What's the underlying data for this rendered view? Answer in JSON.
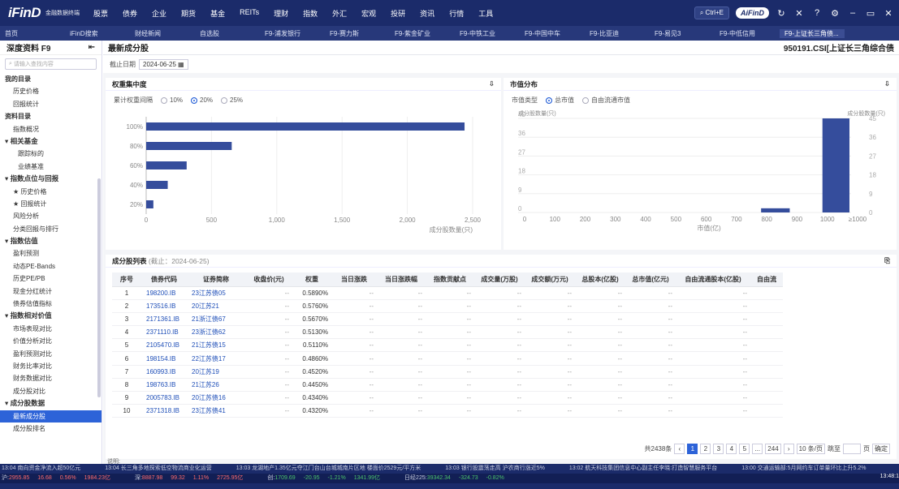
{
  "app": {
    "logo": "iFinD",
    "logo_sub": "金融数据终端",
    "menu": [
      "股票",
      "债券",
      "企业",
      "期货",
      "基金",
      "REITs",
      "理财",
      "指数",
      "外汇",
      "宏观",
      "投研",
      "资讯",
      "行情",
      "工具"
    ],
    "search_hint": "Ctrl+E",
    "aifind": "AiFinD"
  },
  "tabs": [
    "首页",
    "iFinD搜索",
    "财经新闻",
    "自选股",
    "F9-浦发银行",
    "F9-赛力斯",
    "F9-紫金矿业",
    "F9-中铁工业",
    "F9-中国中车",
    "F9-比亚迪",
    "F9-易见3",
    "F9-中低信用",
    "F9-上证长三角债..."
  ],
  "sidebar": {
    "title": "深度资料 F9",
    "search_placeholder": "请输入查找内容",
    "items": [
      {
        "t": "我的目录",
        "k": "g"
      },
      {
        "t": "历史价格",
        "k": "i"
      },
      {
        "t": "回报统计",
        "k": "i"
      },
      {
        "t": "资料目录",
        "k": "g"
      },
      {
        "t": "指数概况",
        "k": "i"
      },
      {
        "t": "▾ 相关基金",
        "k": "s"
      },
      {
        "t": "跟踪标的",
        "k": "i2"
      },
      {
        "t": "业绩基准",
        "k": "i2"
      },
      {
        "t": "▾ 指数点位与回报",
        "k": "s"
      },
      {
        "t": "★ 历史价格",
        "k": "i"
      },
      {
        "t": "★ 回报统计",
        "k": "i"
      },
      {
        "t": "风险分析",
        "k": "i"
      },
      {
        "t": "分类回报与排行",
        "k": "i"
      },
      {
        "t": "▾ 指数估值",
        "k": "s"
      },
      {
        "t": "盈利预测",
        "k": "i"
      },
      {
        "t": "动态PE-Bands",
        "k": "i"
      },
      {
        "t": "历史PE/PB",
        "k": "i"
      },
      {
        "t": "现金分红统计",
        "k": "i"
      },
      {
        "t": "债券估值指标",
        "k": "i"
      },
      {
        "t": "▾ 指数相对价值",
        "k": "s"
      },
      {
        "t": "市场表现对比",
        "k": "i"
      },
      {
        "t": "价值分析对比",
        "k": "i"
      },
      {
        "t": "盈利预测对比",
        "k": "i"
      },
      {
        "t": "财务比率对比",
        "k": "i"
      },
      {
        "t": "财务数据对比",
        "k": "i"
      },
      {
        "t": "成分股对比",
        "k": "i"
      },
      {
        "t": "▾ 成分股数据",
        "k": "s"
      },
      {
        "t": "最新成分股",
        "k": "a"
      },
      {
        "t": "成分股排名",
        "k": "i"
      }
    ]
  },
  "page": {
    "title": "最新成分股",
    "index_name": "950191.CSI[上证长三角综合债",
    "date_label": "截止日期",
    "date": "2024-06-25"
  },
  "weight_panel": {
    "title": "权重集中度",
    "radio_label": "累计权重间隔",
    "options": [
      "10%",
      "20%",
      "25%"
    ],
    "selected": "20%",
    "x_label": "成分股数量(只)"
  },
  "cap_panel": {
    "title": "市值分布",
    "radio_label": "市值类型",
    "options": [
      "总市值",
      "自由流通市值"
    ],
    "selected": "总市值",
    "y_label": "成分股数量(只)",
    "x_label": "市值(亿)"
  },
  "chart_data": [
    {
      "type": "bar",
      "orientation": "horizontal",
      "categories": [
        "100%",
        "80%",
        "60%",
        "40%",
        "20%"
      ],
      "values": [
        2438,
        655,
        310,
        165,
        55
      ],
      "xlim": [
        0,
        2500
      ],
      "xticks": [
        "0",
        "500",
        "1,000",
        "1,500",
        "2,000",
        "2,500"
      ],
      "xlabel": "成分股数量(只)"
    },
    {
      "type": "bar",
      "categories": [
        "0",
        "100",
        "200",
        "300",
        "400",
        "500",
        "600",
        "700",
        "800",
        "900",
        "1000",
        "≥1000"
      ],
      "values": [
        0,
        0,
        0,
        0,
        0,
        0,
        0,
        0,
        2,
        0,
        0,
        45
      ],
      "ylim": [
        0,
        45
      ],
      "yticks": [
        "0",
        "9",
        "18",
        "27",
        "36",
        "45"
      ],
      "ylabel": "成分股数量(只)",
      "xlabel": "市值(亿)"
    }
  ],
  "table": {
    "title": "成分股列表",
    "subtitle": "(截止：2024-06-25)",
    "headers": [
      "序号",
      "债券代码",
      "证券简称",
      "收盘价(元)",
      "权重",
      "当日涨跌",
      "当日涨跌幅",
      "指数贡献点",
      "成交量(万股)",
      "成交额(万元)",
      "总股本(亿股)",
      "总市值(亿元)",
      "自由流通股本(亿股)",
      "自由流"
    ],
    "rows": [
      [
        "1",
        "198200.IB",
        "23江苏债05",
        "--",
        "0.5890%"
      ],
      [
        "2",
        "173516.IB",
        "20江苏21",
        "--",
        "0.5760%"
      ],
      [
        "3",
        "2171361.IB",
        "21浙江债67",
        "--",
        "0.5670%"
      ],
      [
        "4",
        "2371110.IB",
        "23浙江债62",
        "--",
        "0.5130%"
      ],
      [
        "5",
        "2105470.IB",
        "21江苏债15",
        "--",
        "0.5110%"
      ],
      [
        "6",
        "198154.IB",
        "22江苏债17",
        "--",
        "0.4860%"
      ],
      [
        "7",
        "160993.IB",
        "20江苏19",
        "--",
        "0.4520%"
      ],
      [
        "8",
        "198763.IB",
        "21江苏26",
        "--",
        "0.4450%"
      ],
      [
        "9",
        "2005783.IB",
        "20江苏债16",
        "--",
        "0.4340%"
      ],
      [
        "10",
        "2371318.IB",
        "23江苏债41",
        "--",
        "0.4320%"
      ]
    ],
    "total": "共2438条",
    "pages": [
      "1",
      "2",
      "3",
      "4",
      "5",
      "...",
      "244"
    ],
    "per_page": "10 条/页",
    "jump": "跳至",
    "page_unit": "页",
    "confirm": "确定",
    "note": "说明:"
  },
  "ticker": {
    "news": [
      "13:04 南向资金净流入超50亿元",
      "13:04 长三角多地探索低空物流商业化运营",
      "13:03 龙湖地产1.35亿元夺江门台山台城城南片区地 楼面价2529元/平方米",
      "13:03 银行股震荡走高 沪农商行涨近5%",
      "13:02 航天科技集团信息中心副主任李晓:打造智慧服务平台",
      "13:00 交通运输部:5月网约车订单量环比上升5.2%"
    ],
    "quotes": [
      {
        "n": "沪",
        "v": "2955.85",
        "c": "16.68",
        "p": "0.56%",
        "a": "1984.23亿"
      },
      {
        "n": "深",
        "v": "8887.98",
        "c": "99.32",
        "p": "1.11%",
        "a": "2725.95亿"
      },
      {
        "n": "创",
        "v": "1709.69",
        "c": "-20.95",
        "p": "-1.21%",
        "a": "1341.99亿"
      },
      {
        "n": "日经225",
        "v": "39342.34",
        "c": "-324.73",
        "p": "-0.82%",
        "a": ""
      }
    ],
    "time": "13:48:1"
  }
}
